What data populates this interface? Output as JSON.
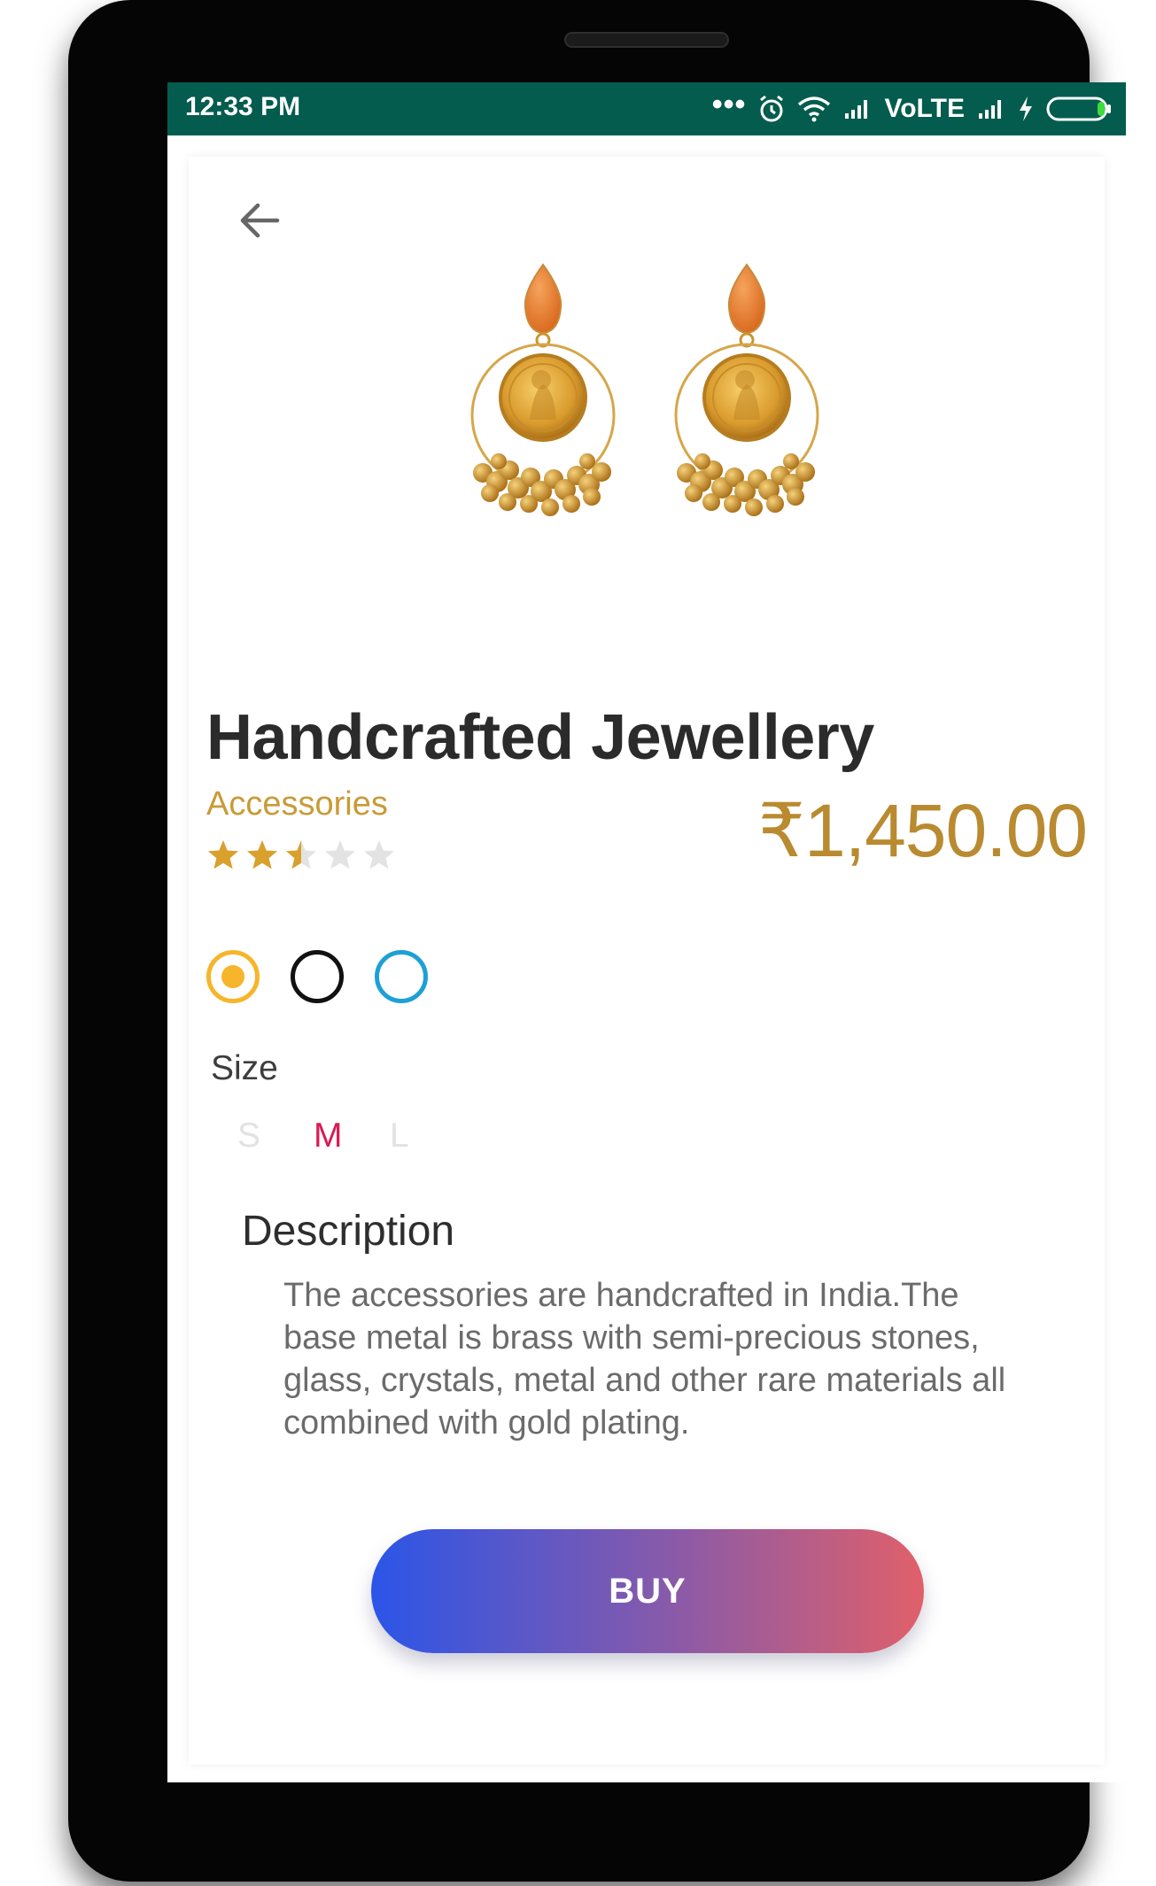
{
  "status_bar": {
    "time": "12:33 PM",
    "dots": "•••",
    "network": "VoLTE",
    "icons": [
      "alarm-icon",
      "wifi-icon",
      "signal-icon",
      "signal-icon",
      "charging-icon",
      "battery-icon"
    ]
  },
  "product": {
    "image": "earrings-image",
    "title": "Handcrafted Jewellery",
    "category": "Accessories",
    "price": "₹1,450.00",
    "rating": 2.5,
    "rating_max": 5
  },
  "colors": {
    "options": [
      "#f6b52a",
      "#111111",
      "#1ea0d6"
    ],
    "selected": 0
  },
  "size": {
    "label": "Size",
    "options": [
      "S",
      "M",
      "L"
    ],
    "selected": "M"
  },
  "description": {
    "title": "Description",
    "text": "The accessories are handcrafted in India.The base metal is brass with semi-precious stones, glass, crystals, metal and other rare materials all combined with gold plating."
  },
  "buy_button": {
    "label": "BUY"
  },
  "theme": {
    "status_bar": "#035c4e",
    "accent_gold": "#c99a36",
    "size_active": "#d81b55",
    "button_gradient": [
      "#2b55e8",
      "#e0606a"
    ]
  }
}
